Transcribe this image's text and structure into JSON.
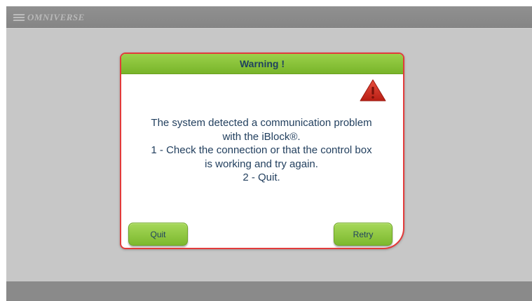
{
  "app": {
    "logo_text": "OMNIVERSE"
  },
  "dialog": {
    "title": "Warning !",
    "message_lines": [
      "The system detected a communication problem",
      "with the iBlock®.",
      "1 - Check the connection or that the control box",
      "is working and try again.",
      "2 - Quit."
    ],
    "quit_label": "Quit",
    "retry_label": "Retry",
    "icon": "warning-triangle-icon"
  },
  "colors": {
    "header_green": "#8cc63f",
    "dialog_border": "#e23b3b",
    "text_navy": "#23405f",
    "warning_red": "#d42a1f",
    "background_gray": "#c7c7c7"
  }
}
